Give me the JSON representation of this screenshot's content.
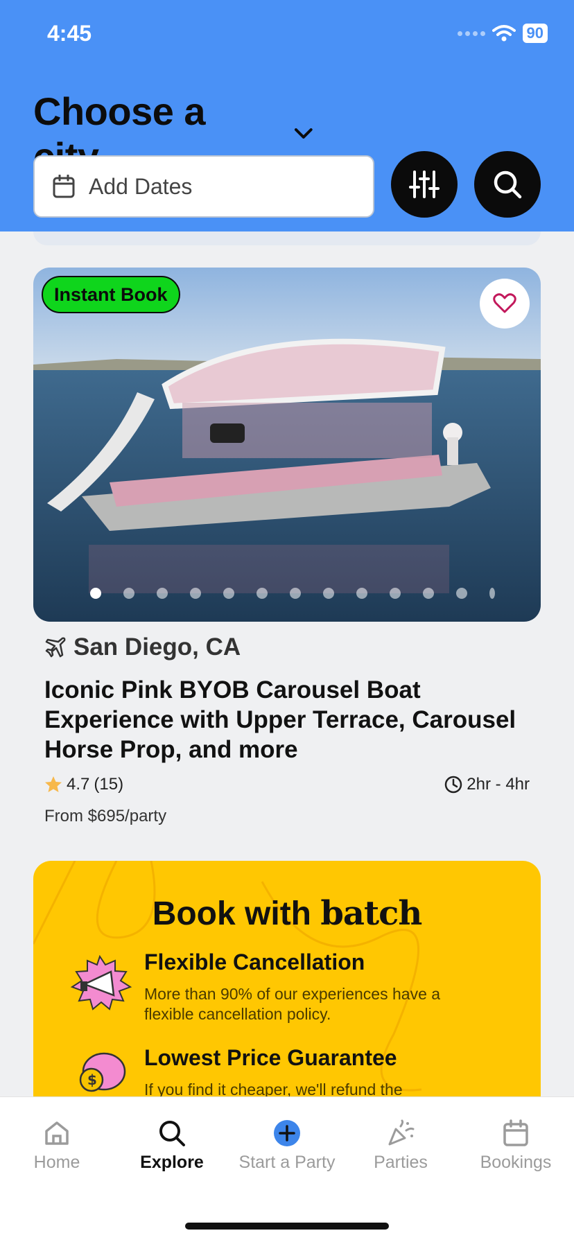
{
  "status_bar": {
    "time": "4:45",
    "battery": "90"
  },
  "header": {
    "city_selector": "Choose a city",
    "dates_placeholder": "Add Dates"
  },
  "listing": {
    "badge": "Instant Book",
    "location": "San Diego, CA",
    "title": "Iconic Pink BYOB Carousel Boat Experience with Upper Terrace, Carousel Horse Prop, and more",
    "rating": "4.7",
    "reviews": "(15)",
    "duration": "2hr - 4hr",
    "price": "From $695/party",
    "photo_count_dots": 13,
    "active_photo": 1
  },
  "promo": {
    "title_prefix": "Book with",
    "brand": "batch",
    "features": [
      {
        "title": "Flexible Cancellation",
        "desc": "More than 90% of our experiences have a flexible cancellation policy."
      },
      {
        "title": "Lowest Price Guarantee",
        "desc": "If you find it cheaper, we'll refund the"
      }
    ]
  },
  "nav": {
    "items": [
      {
        "label": "Home",
        "icon": "home-icon"
      },
      {
        "label": "Explore",
        "icon": "search-icon",
        "active": true
      },
      {
        "label": "Start a Party",
        "icon": "plus-circle-icon"
      },
      {
        "label": "Parties",
        "icon": "party-popper-icon"
      },
      {
        "label": "Bookings",
        "icon": "calendar-icon"
      }
    ]
  },
  "colors": {
    "header": "#4a91f6",
    "badge": "#0fd51c",
    "promo": "#ffc702",
    "heart": "#c2185b"
  }
}
